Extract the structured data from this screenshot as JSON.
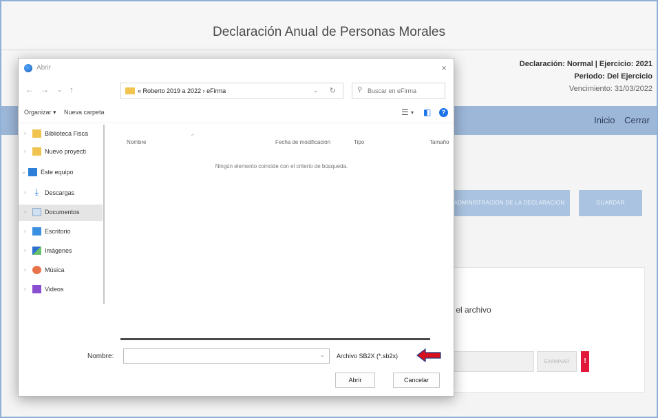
{
  "page": {
    "title": "Declaración Anual de Personas Morales",
    "declaration_info": {
      "line1": "Declaración: Normal | Ejercicio: 2021",
      "line2": "Periodo: Del Ejercicio",
      "line3": "Vencimiento: 31/03/2022"
    },
    "nav": {
      "inicio": "Inicio",
      "cerrar": "Cerrar"
    },
    "buttons": {
      "administracion": "ADMINISTRACIÓN DE LA DECLARACIÓN",
      "guardar": "GUARDAR"
    },
    "panel": {
      "text": "r el archivo",
      "examinar": "EXAMINAR",
      "alert": "!"
    }
  },
  "dialog": {
    "title": "Abrir",
    "close_glyph": "×",
    "address": "« Roberto 2019 a 2022 › eFirma",
    "search_placeholder": "Buscar en eFirma",
    "commands": {
      "organize": "Organizar ▾",
      "new_folder": "Nueva carpeta"
    },
    "nav_items": [
      {
        "label": "Biblioteca Fisca",
        "expander": "›"
      },
      {
        "label": "Nuevo proyecti",
        "expander": "›"
      },
      {
        "label": "Este equipo",
        "expander": "⌄"
      },
      {
        "label": "Descargas",
        "expander": "›"
      },
      {
        "label": "Documentos",
        "expander": "›"
      },
      {
        "label": "Escritorio",
        "expander": "›"
      },
      {
        "label": "Imágenes",
        "expander": "›"
      },
      {
        "label": "Música",
        "expander": "›"
      },
      {
        "label": "Videos",
        "expander": "›"
      }
    ],
    "columns": {
      "name": "Nombre",
      "modified": "Fecha de modificación",
      "type": "Tipo",
      "size": "Tamaño"
    },
    "empty_message": "Ningún elemento coincide con el criterio de búsqueda.",
    "file_name_label": "Nombre:",
    "file_name_value": "",
    "filter": "Archivo SB2X (*.sb2x)",
    "open_label": "Abrir",
    "cancel_label": "Cancelar"
  },
  "colors": {
    "navbar": "#9db7d8",
    "accent_blue": "#1a73e8",
    "alert_red": "#e2183a",
    "arrow_red": "#d8101c"
  }
}
